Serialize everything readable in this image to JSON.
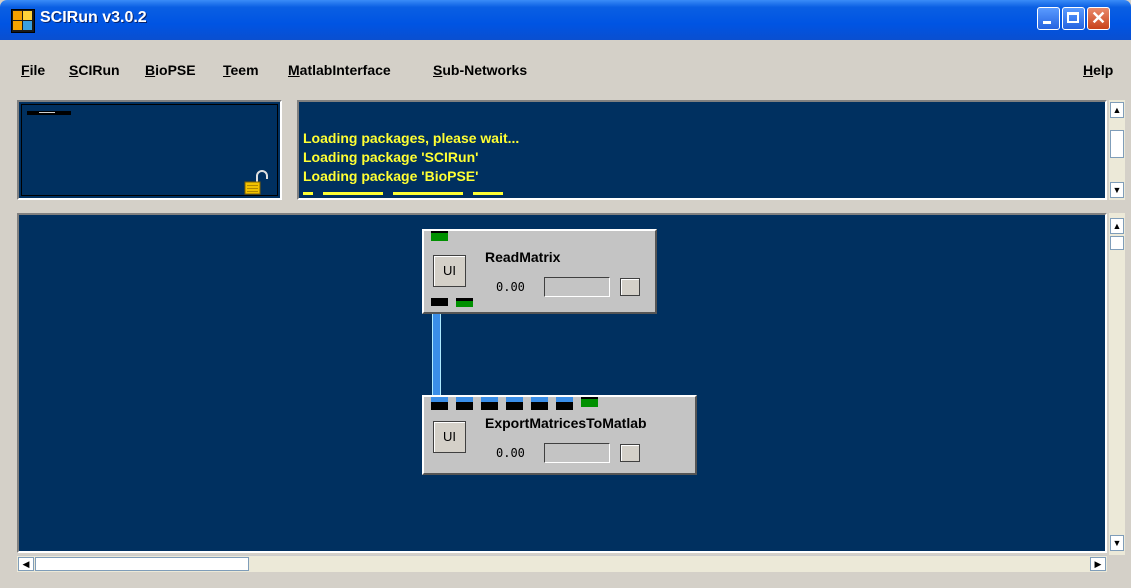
{
  "window": {
    "title": "SCIRun v3.0.2",
    "close_glyph": "✕"
  },
  "menu": [
    {
      "pre": "",
      "u": "F",
      "post": "ile"
    },
    {
      "pre": "",
      "u": "S",
      "post": "CIRun"
    },
    {
      "pre": "",
      "u": "B",
      "post": "ioPSE"
    },
    {
      "pre": "",
      "u": "T",
      "post": "eem"
    },
    {
      "pre": "",
      "u": "M",
      "post": "atlabInterface"
    },
    {
      "pre": "",
      "u": "S",
      "post": "ub-Networks"
    },
    {
      "pre": "",
      "u": "H",
      "post": "elp"
    }
  ],
  "log": {
    "lines": [
      "Loading packages, please wait...",
      "Loading package 'SCIRun'",
      "Loading package 'BioPSE'"
    ]
  },
  "modules": [
    {
      "name": "ReadMatrix",
      "ui_label": "UI",
      "value": "0.00",
      "progress": 0
    },
    {
      "name": "ExportMatricesToMatlab",
      "ui_label": "UI",
      "value": "0.00",
      "progress": 0
    }
  ],
  "colors": {
    "canvas": "#003060",
    "log_text": "#ffff33",
    "port_green": "#009000",
    "port_blue": "#3a8ee8",
    "connection": "#3a8ee8",
    "titlebar": "#0054e3"
  },
  "icons": {
    "lock": "unlocked-padlock-icon",
    "app": "scirun-app-icon"
  }
}
